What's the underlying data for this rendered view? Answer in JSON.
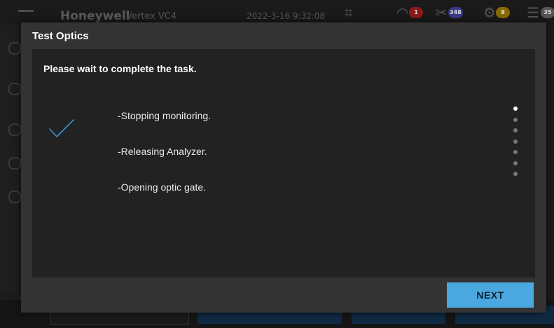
{
  "background_app": {
    "brand": "Honeywell",
    "product": "Vertex VC4",
    "datetime": "2022-3-16   9:32:08",
    "alarm_count": "1",
    "maintenance_count": "348",
    "fault_count": "8",
    "list_count": "35",
    "colors": {
      "alarm_badge": "#8b1a1a",
      "maintenance_badge": "#3a3a8a",
      "fault_badge": "#8a6a00"
    }
  },
  "modal": {
    "title": "Test Optics",
    "message": "Please wait to complete the task.",
    "steps": [
      "-Stopping monitoring.",
      "-Releasing Analyzer.",
      "-Opening optic gate."
    ],
    "progress": {
      "total_dots": 7,
      "active_dot": 1
    },
    "next_label": "NEXT",
    "colors": {
      "accent": "#4aa7e0",
      "check": "#3a8fd0"
    }
  }
}
